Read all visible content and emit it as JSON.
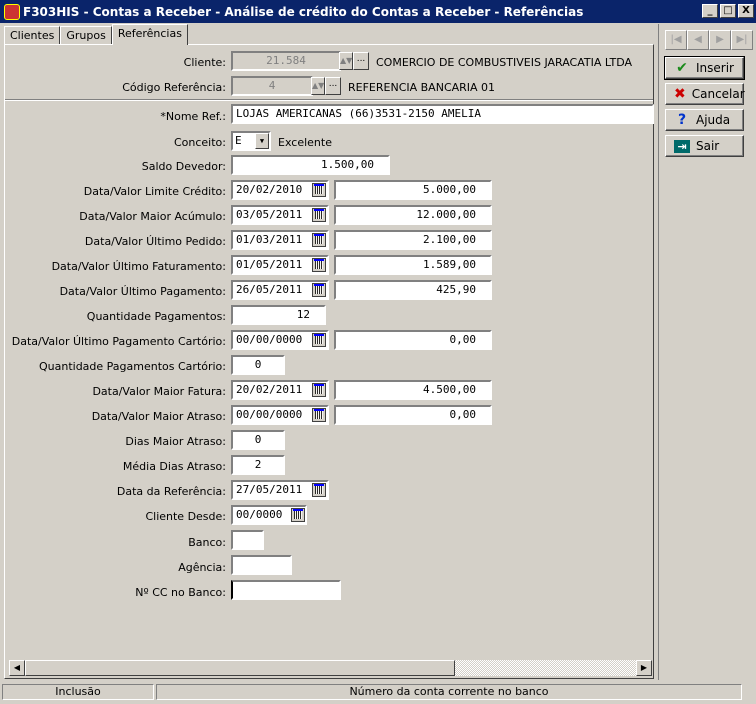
{
  "window": {
    "title": "F303HIS - Contas a Receber - Análise de crédito do Contas a Receber - Referências",
    "min": "_",
    "max": "□",
    "close": "X"
  },
  "tabs": [
    "Clientes",
    "Grupos",
    "Referências"
  ],
  "header": {
    "cliente_label": "Cliente:",
    "cliente_code": "21.584",
    "cliente_name": "COMERCIO DE COMBUSTIVEIS JARACATIA LTDA",
    "codref_label": "Código Referência:",
    "codref_code": "4",
    "codref_name": "REFERENCIA BANCARIA 01"
  },
  "form": {
    "nome_label": "*Nome Ref.:",
    "nome_value": "LOJAS AMERICANAS (66)3531-2150 AMELIA",
    "conceito_label": "Conceito:",
    "conceito_value": "E",
    "conceito_desc": "Excelente",
    "saldo_label": "Saldo Devedor:",
    "saldo_value": "1.500,00",
    "limite_label": "Data/Valor Limite Crédito:",
    "limite_date": "20/02/2010",
    "limite_value": "5.000,00",
    "acumulo_label": "Data/Valor Maior Acúmulo:",
    "acumulo_date": "03/05/2011",
    "acumulo_value": "12.000,00",
    "pedido_label": "Data/Valor Último Pedido:",
    "pedido_date": "01/03/2011",
    "pedido_value": "2.100,00",
    "fatur_label": "Data/Valor Último Faturamento:",
    "fatur_date": "01/05/2011",
    "fatur_value": "1.589,00",
    "pagto_label": "Data/Valor Último Pagamento:",
    "pagto_date": "26/05/2011",
    "pagto_value": "425,90",
    "qtd_label": "Quantidade Pagamentos:",
    "qtd_value": "12",
    "cartorio_label": "Data/Valor Último Pagamento Cartório:",
    "cartorio_date": "00/00/0000",
    "cartorio_value": "0,00",
    "qtdcart_label": "Quantidade Pagamentos Cartório:",
    "qtdcart_value": "0",
    "maiorfat_label": "Data/Valor Maior Fatura:",
    "maiorfat_date": "20/02/2011",
    "maiorfat_value": "4.500,00",
    "atraso_label": "Data/Valor Maior Atraso:",
    "atraso_date": "00/00/0000",
    "atraso_value": "0,00",
    "dias_label": "Dias Maior Atraso:",
    "dias_value": "0",
    "media_label": "Média Dias Atraso:",
    "media_value": "2",
    "dataref_label": "Data da Referência:",
    "dataref_value": "27/05/2011",
    "desde_label": "Cliente Desde:",
    "desde_value": "00/0000",
    "banco_label": "Banco:",
    "banco_value": "",
    "agencia_label": "Agência:",
    "agencia_value": "",
    "cc_label": "Nº CC no Banco:",
    "cc_value": ""
  },
  "actions": {
    "inserir": "Inserir",
    "cancelar": "Cancelar",
    "ajuda": "Ajuda",
    "sair": "Sair"
  },
  "statusbar": {
    "mode": "Inclusão",
    "hint": "Número da conta corrente no banco"
  }
}
